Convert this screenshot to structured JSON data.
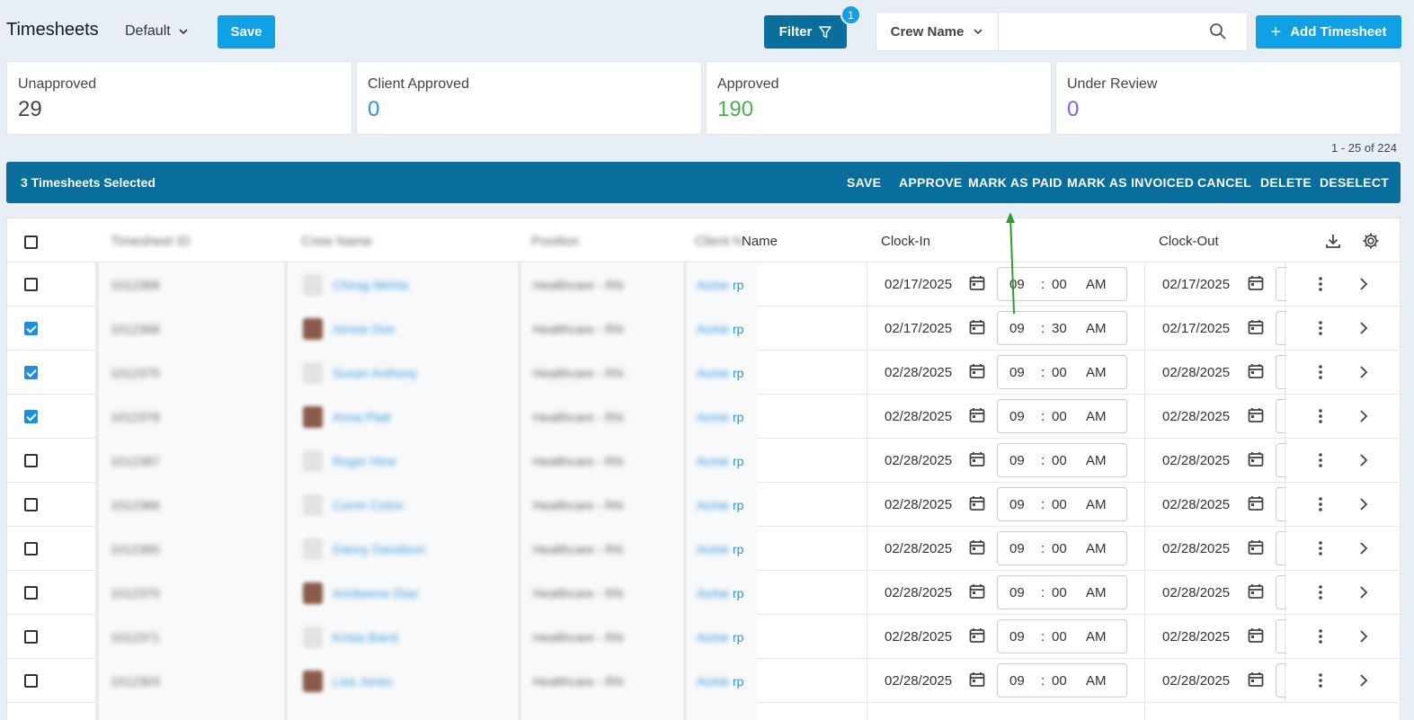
{
  "header": {
    "title": "Timesheets",
    "view": "Default",
    "save_label": "Save",
    "filter_label": "Filter",
    "filter_count": "1",
    "crew_select": "Crew Name",
    "search_placeholder": "",
    "add_label": "Add Timesheet"
  },
  "stats": [
    {
      "label": "Unapproved",
      "value": "29",
      "color": "#444444"
    },
    {
      "label": "Client Approved",
      "value": "0",
      "color": "#2196f3"
    },
    {
      "label": "Approved",
      "value": "190",
      "color": "#4caf50"
    },
    {
      "label": "Under Review",
      "value": "0",
      "color": "#7b61ff"
    }
  ],
  "pagination": "1 - 25 of 224",
  "selection": {
    "count_label": "3 Timesheets Selected",
    "actions": [
      "SAVE",
      "APPROVE",
      "MARK AS PAID",
      "MARK AS INVOICED",
      "CANCEL",
      "DELETE",
      "DESELECT"
    ]
  },
  "columns": {
    "timesheet_id": "Timesheet ID",
    "crew_name": "Crew Name",
    "position": "Position",
    "client_name": "Client Name",
    "client_name_visible": "Name",
    "clock_in": "Clock-In",
    "clock_out": "Clock-Out"
  },
  "rows": [
    {
      "checked": false,
      "id": "1012368",
      "crew": "Chirag Mehta",
      "position": "Healthcare - RN",
      "client": "Acme Corp",
      "in_date": "02/17/2025",
      "hh": "09",
      "mm": "00",
      "ampm": "AM",
      "out_date": "02/17/2025",
      "avatar": "none"
    },
    {
      "checked": true,
      "id": "1012368",
      "crew": "Aimee Doe",
      "position": "Healthcare - RN",
      "client": "Acme Corp",
      "in_date": "02/17/2025",
      "hh": "09",
      "mm": "30",
      "ampm": "AM",
      "out_date": "02/17/2025",
      "avatar": "photo"
    },
    {
      "checked": true,
      "id": "1012375",
      "crew": "Susan Anthony",
      "position": "Healthcare - RN",
      "client": "Acme Corp",
      "in_date": "02/28/2025",
      "hh": "09",
      "mm": "00",
      "ampm": "AM",
      "out_date": "02/28/2025",
      "avatar": "none"
    },
    {
      "checked": true,
      "id": "1012378",
      "crew": "Anna Platt",
      "position": "Healthcare - RN",
      "client": "Acme Corp",
      "in_date": "02/28/2025",
      "hh": "09",
      "mm": "00",
      "ampm": "AM",
      "out_date": "02/28/2025",
      "avatar": "photo"
    },
    {
      "checked": false,
      "id": "1012387",
      "crew": "Roger Hine",
      "position": "Healthcare - RN",
      "client": "Acme Corp",
      "in_date": "02/28/2025",
      "hh": "09",
      "mm": "00",
      "ampm": "AM",
      "out_date": "02/28/2025",
      "avatar": "none"
    },
    {
      "checked": false,
      "id": "1012388",
      "crew": "Corrin Colon",
      "position": "Healthcare - RN",
      "client": "Acme Corp",
      "in_date": "02/28/2025",
      "hh": "09",
      "mm": "00",
      "ampm": "AM",
      "out_date": "02/28/2025",
      "avatar": "none"
    },
    {
      "checked": false,
      "id": "1012380",
      "crew": "Danny Davidson",
      "position": "Healthcare - RN",
      "client": "Acme Corp",
      "in_date": "02/28/2025",
      "hh": "09",
      "mm": "00",
      "ampm": "AM",
      "out_date": "02/28/2025",
      "avatar": "none"
    },
    {
      "checked": false,
      "id": "1012370",
      "crew": "Annbeene Diaz",
      "position": "Healthcare - RN",
      "client": "Acme Corp",
      "in_date": "02/28/2025",
      "hh": "09",
      "mm": "00",
      "ampm": "AM",
      "out_date": "02/28/2025",
      "avatar": "photo2"
    },
    {
      "checked": false,
      "id": "1012371",
      "crew": "Krista Baird",
      "position": "Healthcare - RN",
      "client": "Acme Corp",
      "in_date": "02/28/2025",
      "hh": "09",
      "mm": "00",
      "ampm": "AM",
      "out_date": "02/28/2025",
      "avatar": "none"
    },
    {
      "checked": false,
      "id": "1012303",
      "crew": "Lisa Jones",
      "position": "Healthcare - RN",
      "client": "Acme Corp",
      "in_date": "02/28/2025",
      "hh": "09",
      "mm": "00",
      "ampm": "AM",
      "out_date": "02/28/2025",
      "avatar": "photo"
    }
  ]
}
